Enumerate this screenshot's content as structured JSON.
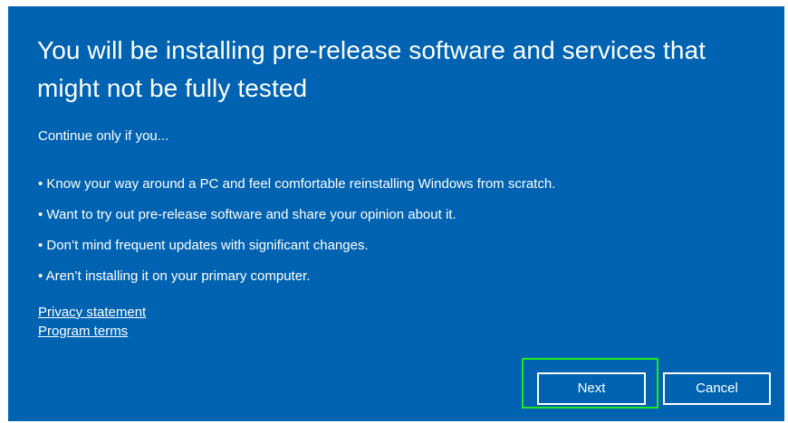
{
  "dialog": {
    "title": "You will be installing pre-release software and services that might not be fully tested",
    "intro": "Continue only if you...",
    "bullets": [
      "• Know your way around a PC and feel comfortable reinstalling Windows from scratch.",
      "• Want to try out pre-release software and share your opinion about it.",
      "• Don’t mind frequent updates with significant changes.",
      "• Aren’t installing it on your primary computer."
    ],
    "links": {
      "privacy": "Privacy statement",
      "terms": "Program terms"
    },
    "buttons": {
      "next": "Next",
      "cancel": "Cancel"
    },
    "colors": {
      "background": "#0063B1",
      "text": "#FFFFFF",
      "highlight": "#22E81E"
    }
  }
}
